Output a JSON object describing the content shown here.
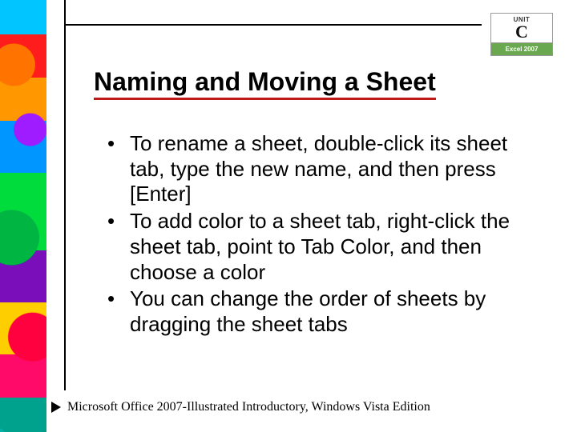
{
  "badge": {
    "unit_label": "UNIT",
    "unit_letter": "C",
    "product": "Excel 2007"
  },
  "title": "Naming and Moving a Sheet",
  "bullets": [
    "To rename a sheet, double-click its sheet tab, type the new name, and then press [Enter]",
    "To add color to a sheet tab, right-click the sheet tab, point to Tab Color, and then choose a color",
    "You can change the order of sheets by dragging the sheet tabs"
  ],
  "footer": "Microsoft Office 2007-Illustrated Introductory, Windows Vista Edition"
}
